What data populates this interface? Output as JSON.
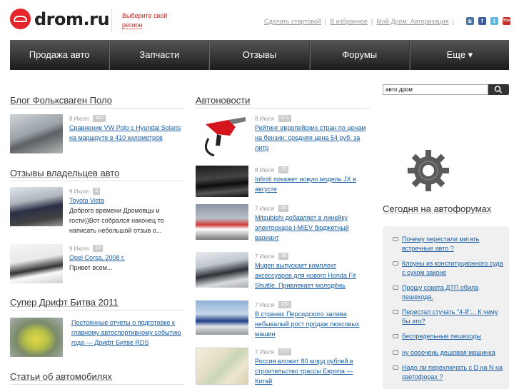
{
  "header": {
    "logo_text": "drom.ru",
    "region_text_1": "Выберите свой",
    "region_text_2": "регион",
    "links": [
      "Сделать стартовой",
      "В избранное",
      "Мой Дром: Авторизация"
    ],
    "social_icons": [
      "vk-icon",
      "facebook-icon",
      "twitter-icon",
      "youtube-icon"
    ]
  },
  "nav": [
    "Продажа авто",
    "Запчасти",
    "Отзывы",
    "Форумы",
    "Еще ▾"
  ],
  "blog": {
    "heading": "Блог Фольксваген Поло",
    "items": [
      {
        "date": "8 Июля",
        "count": "340",
        "title": "Сравнение VW Polo с Hyundai Solaris на маршруте в 410 километров"
      }
    ]
  },
  "reviews": {
    "heading": "Отзывы владельцев авто",
    "items": [
      {
        "date": "9 Июля",
        "count": "3",
        "title": "Toyota Vista",
        "desc": "Доброго времени Дромовцы и гости))Вот собрался наконец то написать небольшой отзыв о..."
      },
      {
        "date": "9 Июля",
        "count": "10",
        "title": "Opel Corsa, 2008 г.",
        "desc": "Привет всем..."
      }
    ]
  },
  "drift": {
    "heading": "Супер Дрифт Битва 2011",
    "title": "Постоянные отчеты о подготовке к главному автоспортивному событию года — Дрифт Битве RDS"
  },
  "articles": {
    "heading": "Статьи об автомобилях"
  },
  "news": {
    "heading": "Автоновости",
    "items": [
      {
        "date": "8 Июля",
        "count": "271",
        "title": "Рейтинг европейских стран по ценам на бензин: средняя цена 54 руб. за литр"
      },
      {
        "date": "8 Июля",
        "count": "20",
        "title": "Infiniti покажет новую модель JX в августе"
      },
      {
        "date": "7 Июля",
        "count": "58",
        "title": "Mitsubishi добавляет в линейку электрокара i-MiEV бюджетный вариант"
      },
      {
        "date": "7 Июля",
        "count": "38",
        "title": "Mugen выпускает комплект аксессуаров для нового Honda Fit Shuttle. Привлекает молодёжь"
      },
      {
        "date": "7 Июля",
        "count": "100",
        "title": "В странах Персидского залива небывалый рост продаж люксовых машин"
      },
      {
        "date": "7 Июля",
        "count": "217",
        "title": "Россия вложит 80 млрд рублей в строительство трассы Европа — Китай"
      }
    ]
  },
  "search": {
    "value": "авто дром"
  },
  "forums": {
    "heading": "Сегодня на автофорумах",
    "items": [
      "Почему перестали мигать встречные авто ?",
      "Клоуны из конституционного суда с сухом законе",
      "Прошу совета ДТП обила пешехода.",
      "Перестал стучать \"4-й\"... К чему бы это?",
      "беспредельные пешеходы",
      "ну оооочень дешовая машинка",
      "Надо ли переключать с D на N на светофорах ?"
    ]
  },
  "colors": {
    "brand": "#e3242b",
    "link": "#1a5fa6",
    "nav_bg": "#2a2a2a"
  }
}
